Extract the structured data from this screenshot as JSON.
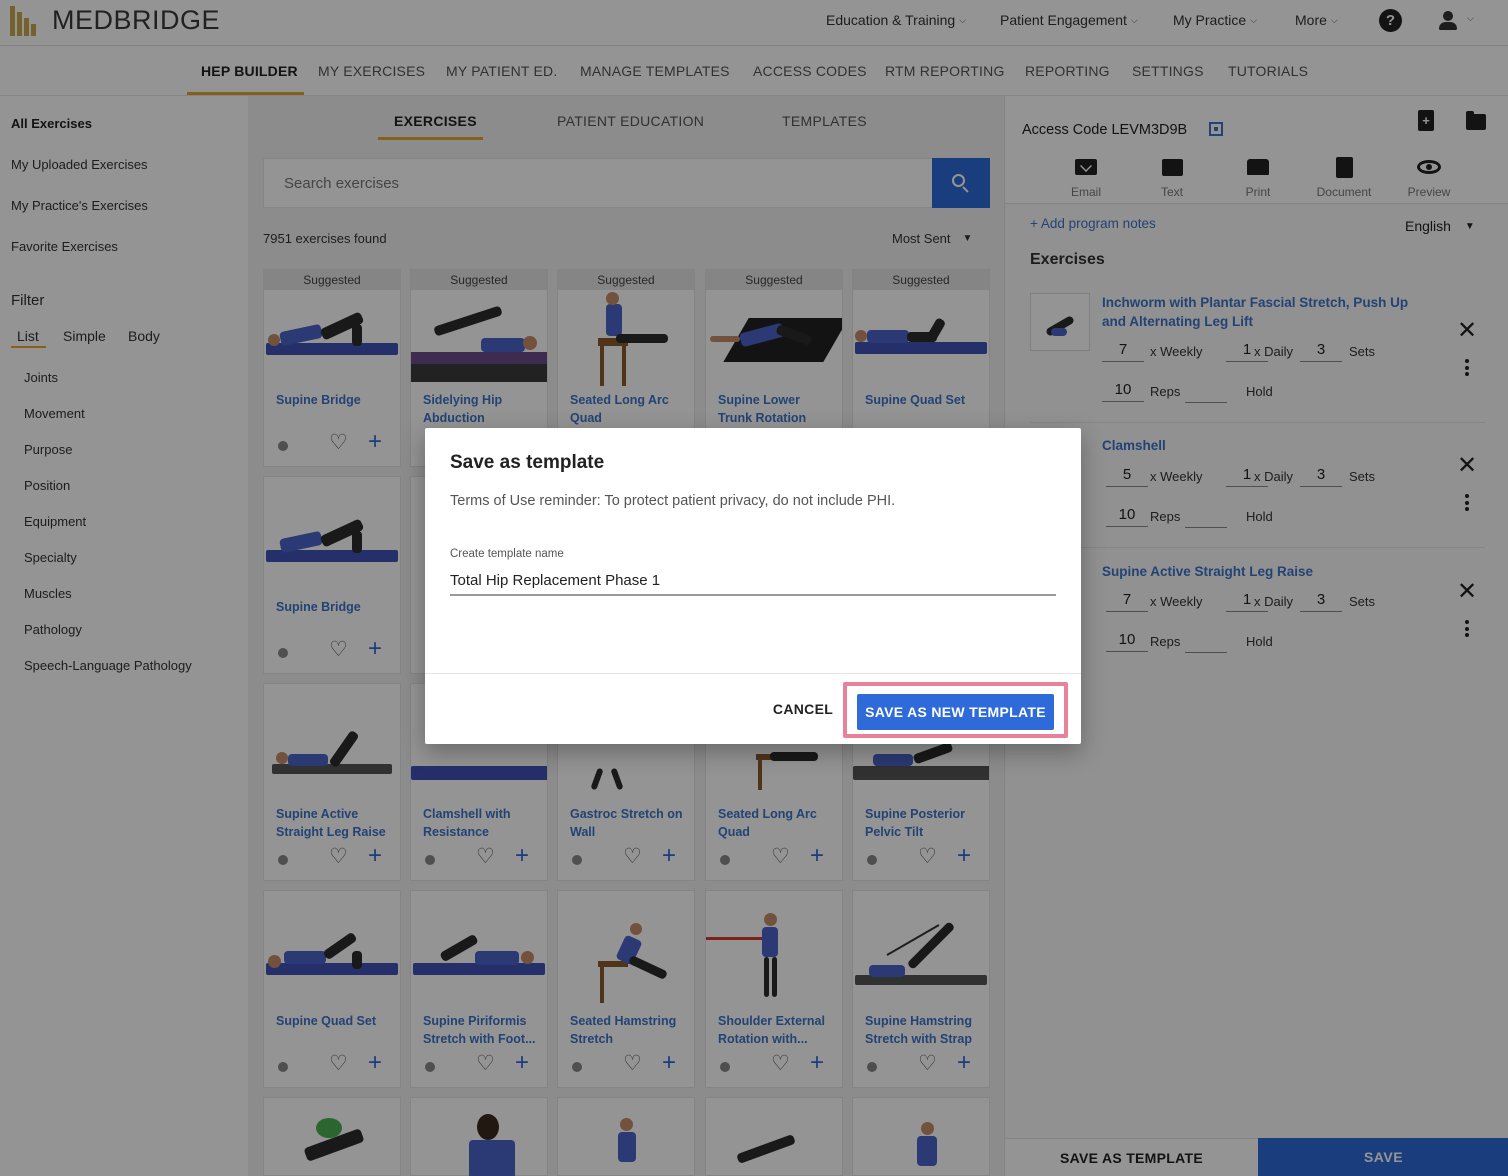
{
  "brand": {
    "name": "MEDBRIDGE"
  },
  "topnav": [
    {
      "label": "Education & Training"
    },
    {
      "label": "Patient Engagement"
    },
    {
      "label": "My Practice"
    },
    {
      "label": "More"
    }
  ],
  "help": {
    "glyph": "?"
  },
  "secnav": [
    {
      "label": "HEP BUILDER"
    },
    {
      "label": "MY EXERCISES"
    },
    {
      "label": "MY PATIENT ED."
    },
    {
      "label": "MANAGE TEMPLATES"
    },
    {
      "label": "ACCESS CODES"
    },
    {
      "label": "RTM REPORTING"
    },
    {
      "label": "REPORTING"
    },
    {
      "label": "SETTINGS"
    },
    {
      "label": "TUTORIALS"
    }
  ],
  "sidebar": {
    "links": [
      {
        "label": "All Exercises"
      },
      {
        "label": "My Uploaded Exercises"
      },
      {
        "label": "My Practice's Exercises"
      },
      {
        "label": "Favorite Exercises"
      }
    ],
    "filter_title": "Filter",
    "filter_tabs": [
      {
        "label": "List"
      },
      {
        "label": "Simple"
      },
      {
        "label": "Body"
      }
    ],
    "facets": [
      {
        "label": "Joints"
      },
      {
        "label": "Movement"
      },
      {
        "label": "Purpose"
      },
      {
        "label": "Position"
      },
      {
        "label": "Equipment"
      },
      {
        "label": "Specialty"
      },
      {
        "label": "Muscles"
      },
      {
        "label": "Pathology"
      },
      {
        "label": "Speech-Language Pathology"
      }
    ]
  },
  "middle": {
    "tabs": [
      {
        "label": "EXERCISES"
      },
      {
        "label": "PATIENT EDUCATION"
      },
      {
        "label": "TEMPLATES"
      }
    ],
    "search_placeholder": "Search exercises",
    "found": "7951 exercises found",
    "sort": "Most Sent",
    "suggested_label": "Suggested",
    "cards": [
      {
        "title": "Supine Bridge"
      },
      {
        "title": "Sidelying Hip Abduction"
      },
      {
        "title": "Seated Long Arc Quad"
      },
      {
        "title": "Supine Lower Trunk Rotation"
      },
      {
        "title": "Supine Quad Set"
      },
      {
        "title": "Supine Bridge"
      },
      {
        "title": "Supine Active Straight Leg Raise"
      },
      {
        "title": "Clamshell with Resistance"
      },
      {
        "title": "Gastroc Stretch on Wall"
      },
      {
        "title": "Seated Long Arc Quad"
      },
      {
        "title": "Supine Posterior Pelvic Tilt"
      },
      {
        "title": "Supine Quad Set"
      },
      {
        "title": "Supine Piriformis Stretch with Foot..."
      },
      {
        "title": "Seated Hamstring Stretch"
      },
      {
        "title": "Shoulder External Rotation with..."
      },
      {
        "title": "Supine Hamstring Stretch with Strap"
      }
    ]
  },
  "program": {
    "access_code": "Access Code LEVM3D9B",
    "new_doc_glyph": "+",
    "share": [
      {
        "label": "Email",
        "icon": "email-icon"
      },
      {
        "label": "Text",
        "icon": "text-message-icon"
      },
      {
        "label": "Print",
        "icon": "print-icon"
      },
      {
        "label": "Document",
        "icon": "document-icon"
      },
      {
        "label": "Preview",
        "icon": "eye-icon"
      }
    ],
    "add_notes": "+ Add program notes",
    "language": "English",
    "exercises_heading": "Exercises",
    "labels": {
      "weekly": "x Weekly",
      "daily": "x Daily",
      "sets": "Sets",
      "reps": "Reps",
      "hold": "Hold"
    },
    "exercises": [
      {
        "title": "Inchworm with Plantar Fascial Stretch, Push Up and Alternating Leg Lift",
        "weekly": "7",
        "daily": "1",
        "sets": "3",
        "reps": "10",
        "hold": ""
      },
      {
        "title": "Clamshell",
        "weekly": "5",
        "daily": "1",
        "sets": "3",
        "reps": "10",
        "hold": ""
      },
      {
        "title": "Supine Active Straight Leg Raise",
        "weekly": "7",
        "daily": "1",
        "sets": "3",
        "reps": "10",
        "hold": ""
      }
    ],
    "save_template_label": "SAVE AS TEMPLATE",
    "save_label": "SAVE"
  },
  "dialog": {
    "title": "Save as template",
    "subtitle": "Terms of Use reminder: To protect patient privacy, do not include PHI.",
    "field_label": "Create template name",
    "field_value": "Total Hip Replacement Phase 1",
    "cancel_label": "CANCEL",
    "save_label": "SAVE AS NEW TEMPLATE",
    "highlight_color": "#e8829b"
  },
  "colors": {
    "accent": "#2e6bd8",
    "link": "#3d74c9",
    "tab_underline": "#e3a62f",
    "brand_gold": "#c8a84e"
  }
}
